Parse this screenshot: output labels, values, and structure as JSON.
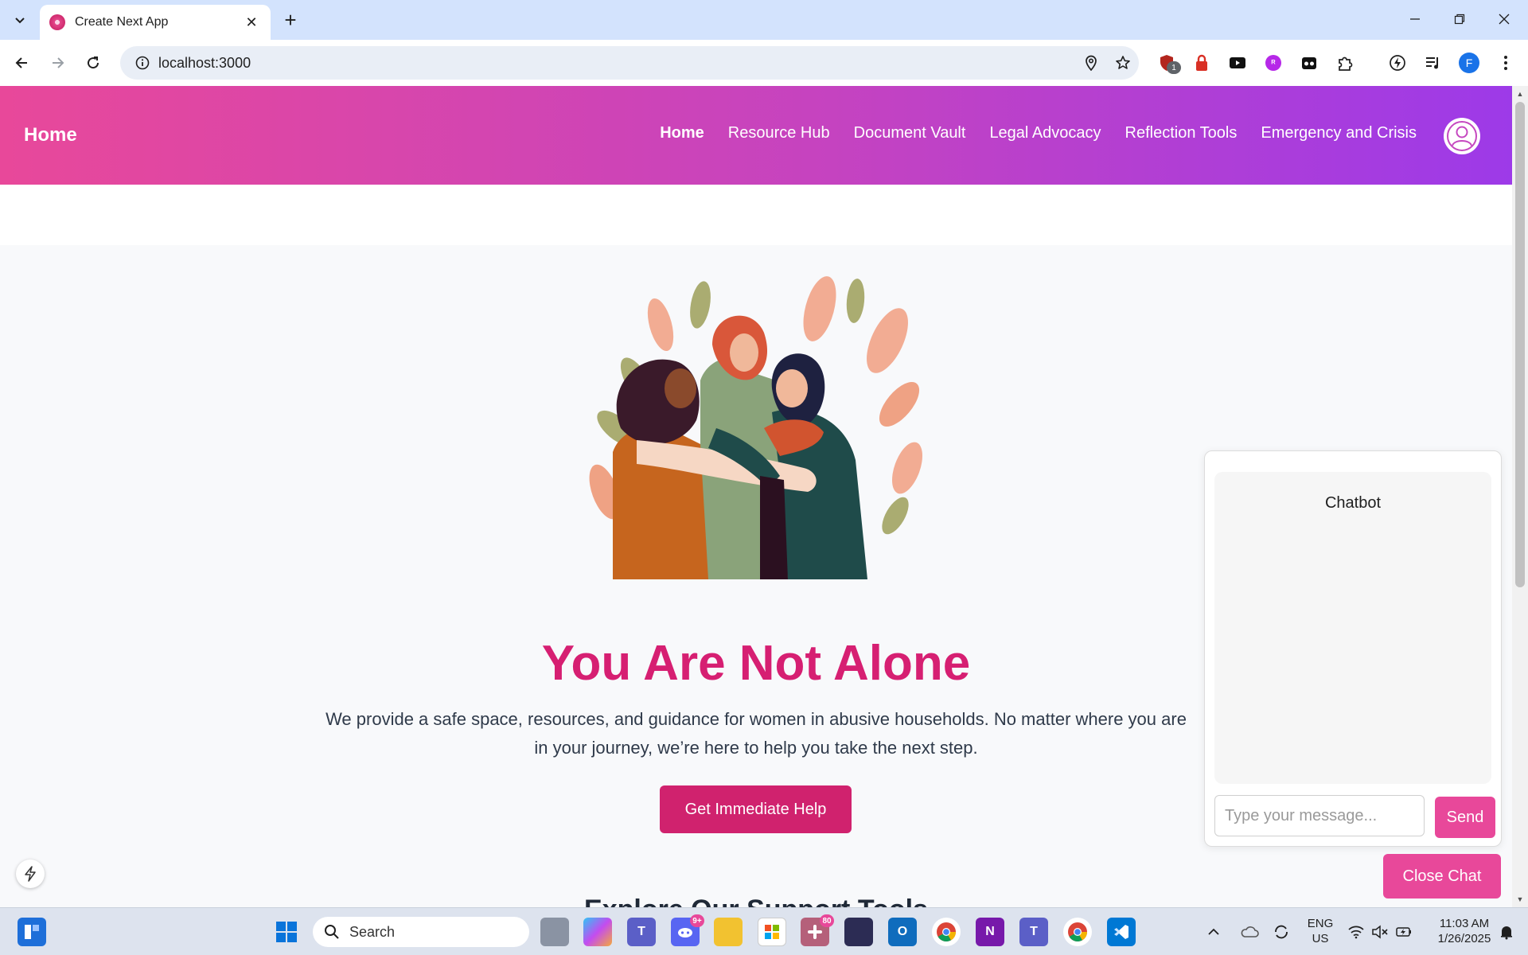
{
  "browser": {
    "tab_title": "Create Next App",
    "url": "localhost:3000",
    "profile_initial": "F",
    "shield_badge": "1"
  },
  "site": {
    "brand": "Home",
    "nav": [
      "Home",
      "Resource Hub",
      "Document Vault",
      "Legal Advocacy",
      "Reflection Tools",
      "Emergency and Crisis"
    ],
    "active_nav": "Home"
  },
  "hero": {
    "title": "You Are Not Alone",
    "subtitle": "We provide a safe space, resources, and guidance for women in abusive households. No matter where you are in your journey, we’re here to help you take the next step.",
    "cta_label": "Get Immediate Help",
    "next_section_peek": "Explore Our Support Tools"
  },
  "chatbot": {
    "title": "Chatbot",
    "input_placeholder": "Type your message...",
    "send_label": "Send",
    "close_label": "Close Chat"
  },
  "taskbar": {
    "search_label": "Search",
    "discord_badge": "9+",
    "slack_badge": "80",
    "language": "ENG",
    "region": "US",
    "time": "11:03 AM",
    "date": "1/26/2025"
  },
  "colors": {
    "header_gradient_start": "#e8489a",
    "header_gradient_end": "#9d3ae8",
    "hero_title": "#d61f72",
    "cta": "#d0226e",
    "chat_button": "#e8489a"
  }
}
